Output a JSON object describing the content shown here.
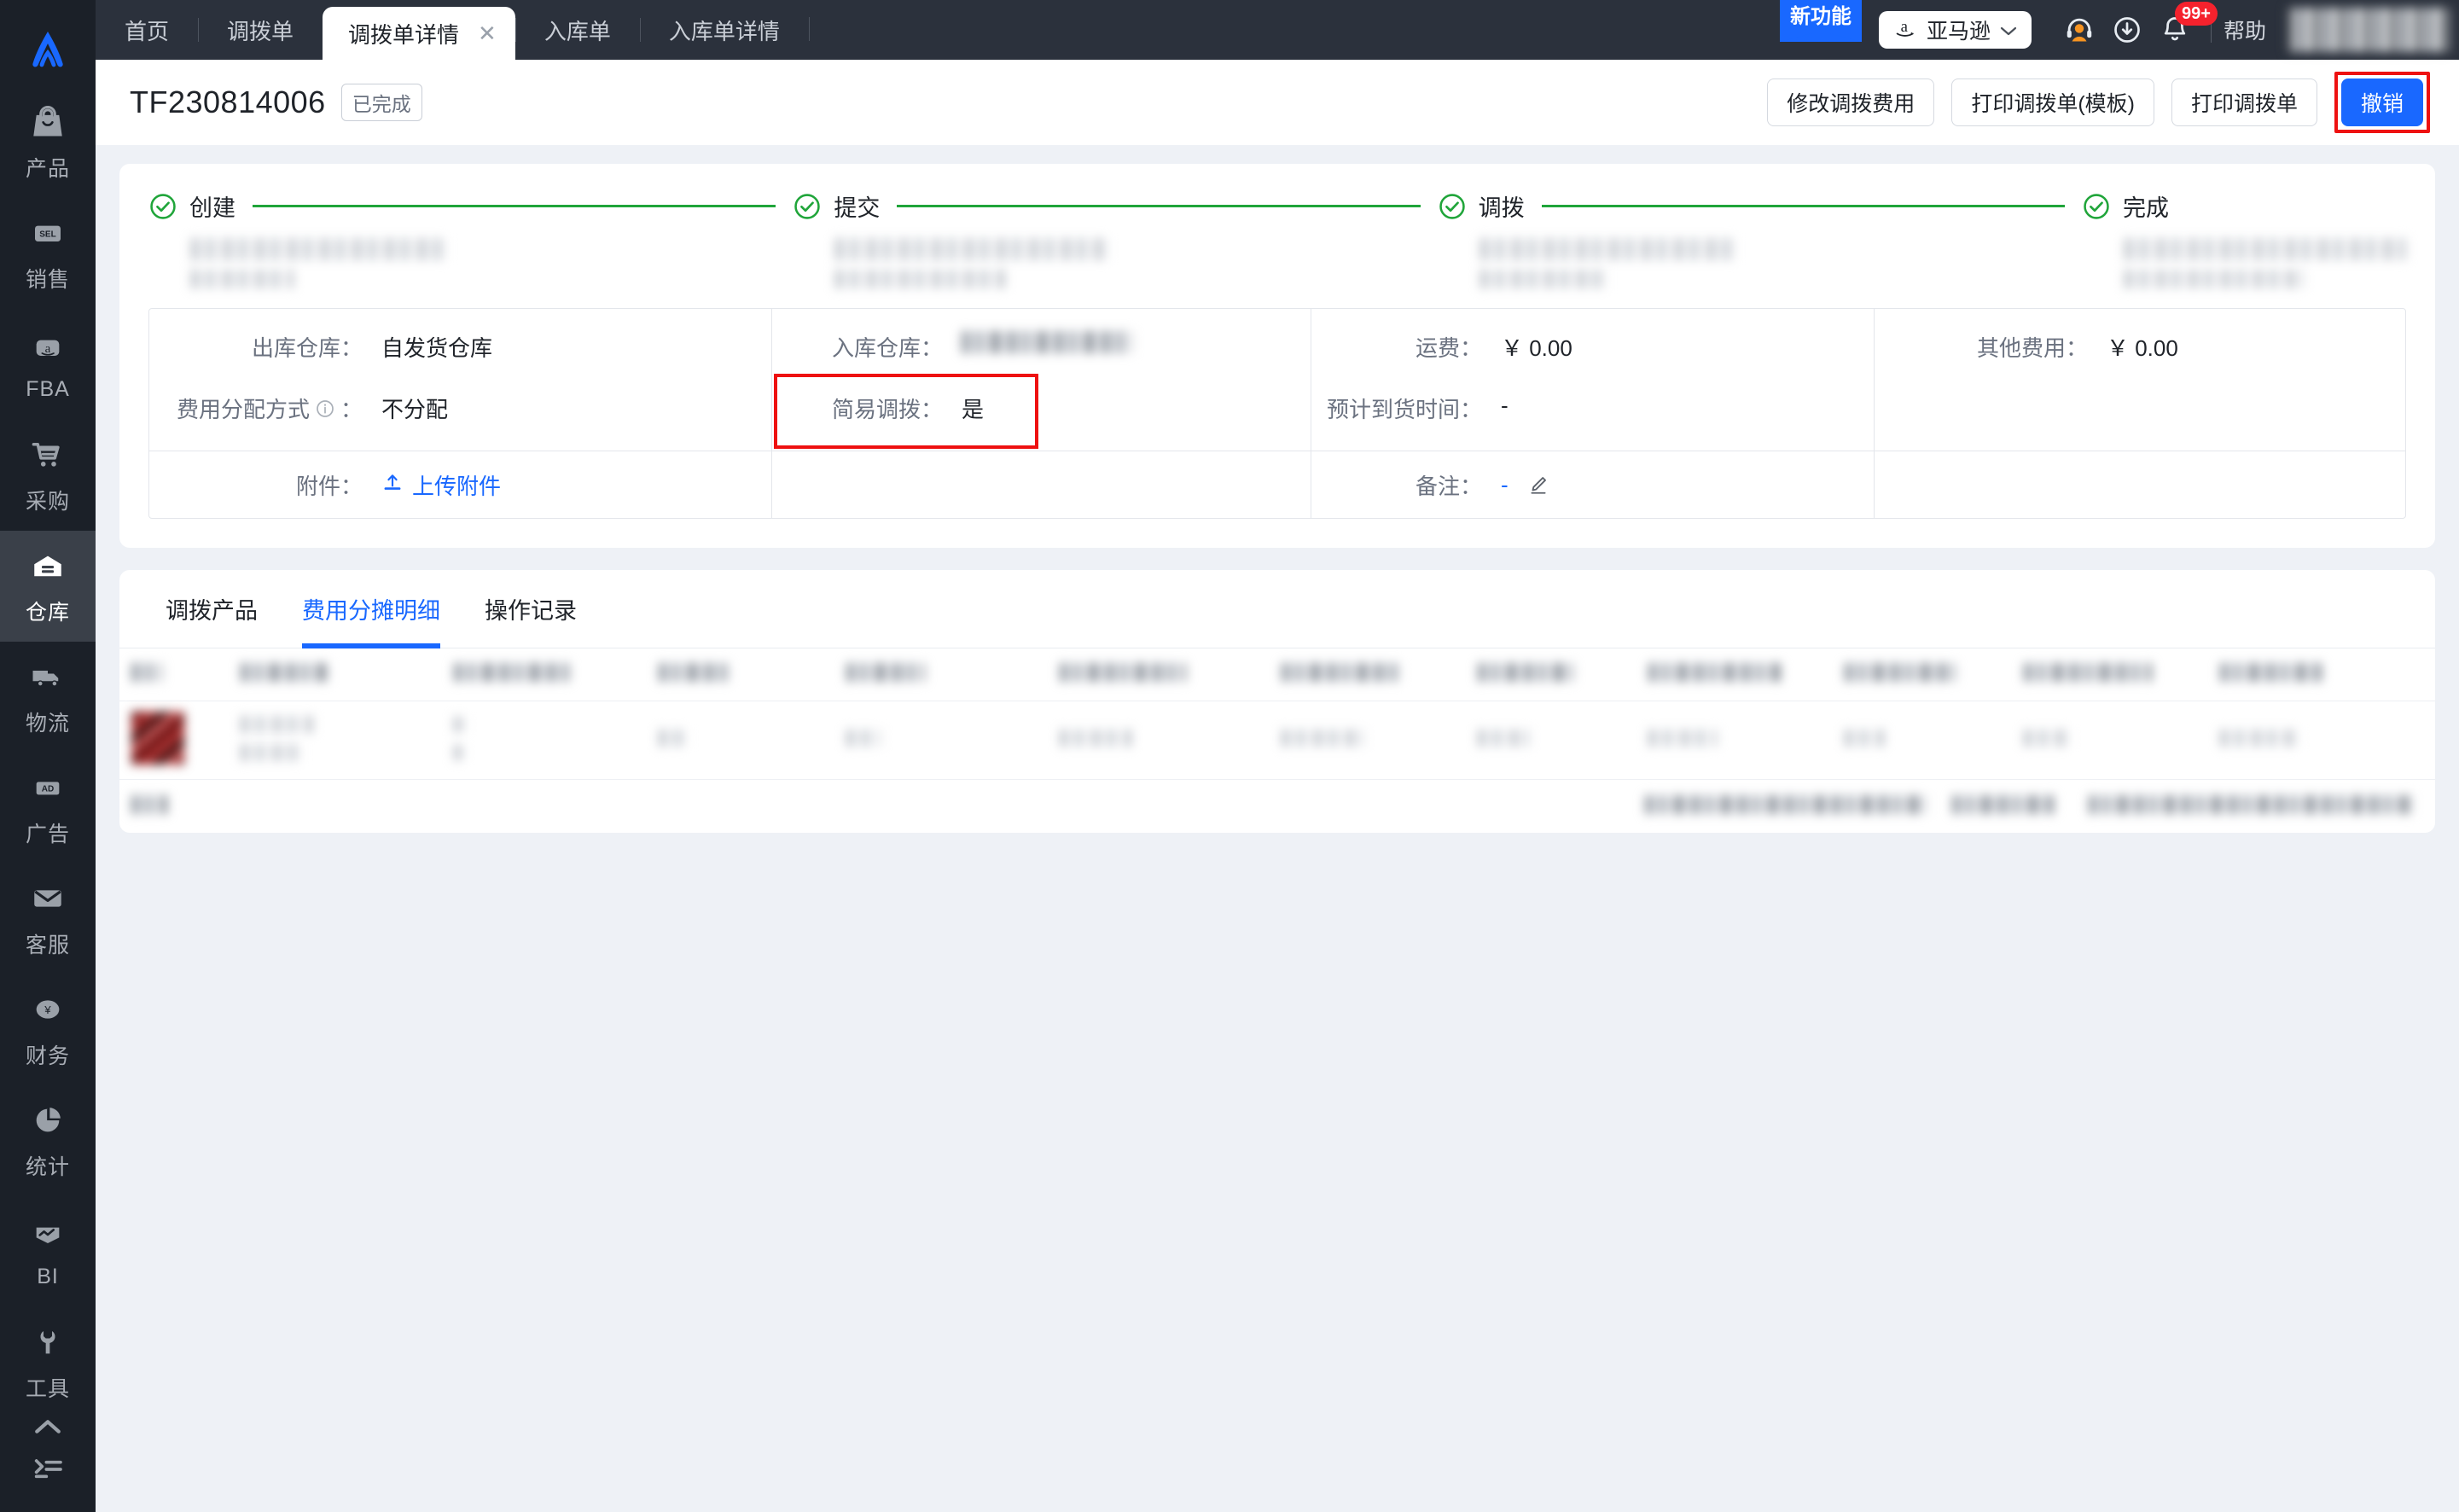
{
  "brand": {
    "logo_name": "lingxing-logo",
    "accent": "#1968ff"
  },
  "sidebar": {
    "items": [
      {
        "label": "产品",
        "icon": "bag-icon",
        "name": "sidebar-item-product",
        "active": false
      },
      {
        "label": "销售",
        "icon": "sell-tag-icon",
        "name": "sidebar-item-sales",
        "active": false
      },
      {
        "label": "FBA",
        "icon": "amazon-box-icon",
        "name": "sidebar-item-fba",
        "active": false
      },
      {
        "label": "采购",
        "icon": "cart-icon",
        "name": "sidebar-item-purchase",
        "active": false
      },
      {
        "label": "仓库",
        "icon": "warehouse-icon",
        "name": "sidebar-item-warehouse",
        "active": true
      },
      {
        "label": "物流",
        "icon": "truck-icon",
        "name": "sidebar-item-logistics",
        "active": false
      },
      {
        "label": "广告",
        "icon": "ad-icon",
        "name": "sidebar-item-ads",
        "active": false
      },
      {
        "label": "客服",
        "icon": "mail-icon",
        "name": "sidebar-item-service",
        "active": false
      },
      {
        "label": "财务",
        "icon": "yen-coin-icon",
        "name": "sidebar-item-finance",
        "active": false
      },
      {
        "label": "统计",
        "icon": "pie-chart-icon",
        "name": "sidebar-item-statistics",
        "active": false
      },
      {
        "label": "BI",
        "icon": "bi-chart-icon",
        "name": "sidebar-item-bi",
        "active": false
      },
      {
        "label": "工具",
        "icon": "wrench-icon",
        "name": "sidebar-item-tools",
        "active": false
      }
    ],
    "collapse_icon": "chevron-up-icon",
    "menu_icon": "list-menu-icon"
  },
  "topbar": {
    "tabs": [
      {
        "label": "首页",
        "active": false
      },
      {
        "label": "调拨单",
        "active": false
      },
      {
        "label": "调拨单详情",
        "active": true,
        "closable": true
      },
      {
        "label": "入库单",
        "active": false
      },
      {
        "label": "入库单详情",
        "active": false
      }
    ],
    "close_glyph": "✕",
    "new_feature_badge": "新功能",
    "platform": {
      "label": "亚马逊",
      "icon": "amazon-a-icon",
      "chevron": "chevron-down-icon"
    },
    "icons": [
      {
        "name": "headset-support-icon"
      },
      {
        "name": "download-icon"
      },
      {
        "name": "bell-notification-icon",
        "badge": "99+"
      }
    ],
    "help_label": "帮助"
  },
  "page": {
    "doc_no": "TF230814006",
    "status": "已完成",
    "actions": [
      {
        "label": "修改调拨费用",
        "name": "edit-transfer-fee-button",
        "primary": false,
        "highlight": false
      },
      {
        "label": "打印调拨单(模板)",
        "name": "print-transfer-template-button",
        "primary": false,
        "highlight": false
      },
      {
        "label": "打印调拨单",
        "name": "print-transfer-button",
        "primary": false,
        "highlight": false
      },
      {
        "label": "撤销",
        "name": "revoke-button",
        "primary": true,
        "highlight": true
      }
    ]
  },
  "steps": [
    {
      "label": "创建",
      "state": "done"
    },
    {
      "label": "提交",
      "state": "done"
    },
    {
      "label": "调拨",
      "state": "done"
    },
    {
      "label": "完成",
      "state": "done"
    }
  ],
  "info": {
    "out_warehouse_label": "出库仓库：",
    "out_warehouse_value": "自发货仓库",
    "fee_alloc_label": "费用分配方式",
    "fee_alloc_info_icon": "info-circle-icon",
    "fee_alloc_colon": "：",
    "fee_alloc_value": "不分配",
    "attachment_label": "附件：",
    "attachment_action": "上传附件",
    "attachment_icon": "upload-icon",
    "in_warehouse_label": "入库仓库：",
    "in_warehouse_value": "",
    "simple_transfer_label": "简易调拨：",
    "simple_transfer_value": "是",
    "freight_label": "运费：",
    "freight_value": "￥ 0.00",
    "eta_label": "预计到货时间：",
    "eta_value": "-",
    "remark_label": "备注：",
    "remark_value": "-",
    "remark_edit_icon": "pencil-edit-icon",
    "other_fee_label": "其他费用：",
    "other_fee_value": "￥ 0.00",
    "highlight_color": "#ee1111"
  },
  "content_tabs": [
    {
      "label": "调拨产品",
      "active": false
    },
    {
      "label": "费用分摊明细",
      "active": true
    },
    {
      "label": "操作记录",
      "active": false
    }
  ],
  "table": {
    "redacted": true,
    "note": "表格内容已打码",
    "header_columns": 12,
    "body_rows": 1,
    "footer_row": true
  }
}
